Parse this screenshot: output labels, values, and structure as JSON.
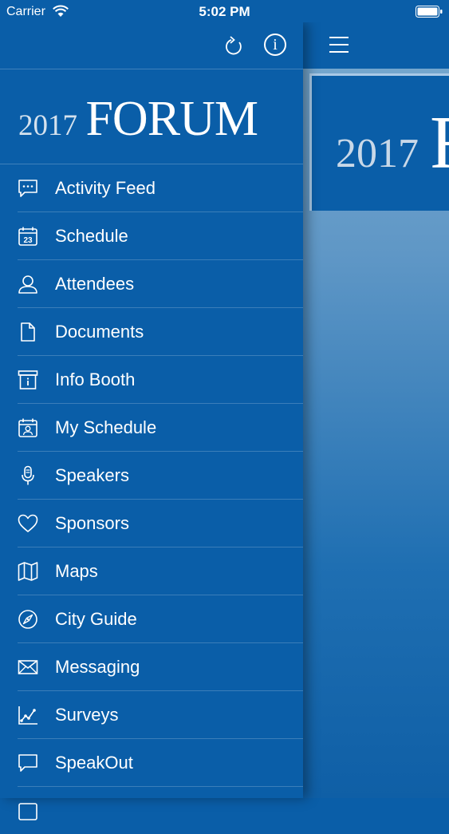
{
  "status_bar": {
    "carrier": "Carrier",
    "time": "5:02 PM"
  },
  "sidebar": {
    "logo": {
      "year": "2017",
      "word": "FORUM"
    },
    "info_glyph": "i",
    "items": [
      {
        "label": "Activity Feed",
        "icon": "chat-bubble-icon"
      },
      {
        "label": "Schedule",
        "icon": "calendar-icon",
        "icon_text": "23"
      },
      {
        "label": "Attendees",
        "icon": "person-icon"
      },
      {
        "label": "Documents",
        "icon": "document-icon"
      },
      {
        "label": "Info Booth",
        "icon": "info-booth-icon"
      },
      {
        "label": "My Schedule",
        "icon": "calendar-person-icon"
      },
      {
        "label": "Speakers",
        "icon": "microphone-icon"
      },
      {
        "label": "Sponsors",
        "icon": "heart-icon"
      },
      {
        "label": "Maps",
        "icon": "map-icon"
      },
      {
        "label": "City Guide",
        "icon": "compass-icon"
      },
      {
        "label": "Messaging",
        "icon": "envelope-icon"
      },
      {
        "label": "Surveys",
        "icon": "chart-icon"
      },
      {
        "label": "SpeakOut",
        "icon": "speech-bubble-icon"
      }
    ]
  },
  "main": {
    "banner": {
      "year": "2017",
      "word": "F"
    }
  },
  "colors": {
    "brand": "#0a5ea8",
    "accent": "#ffffff"
  }
}
